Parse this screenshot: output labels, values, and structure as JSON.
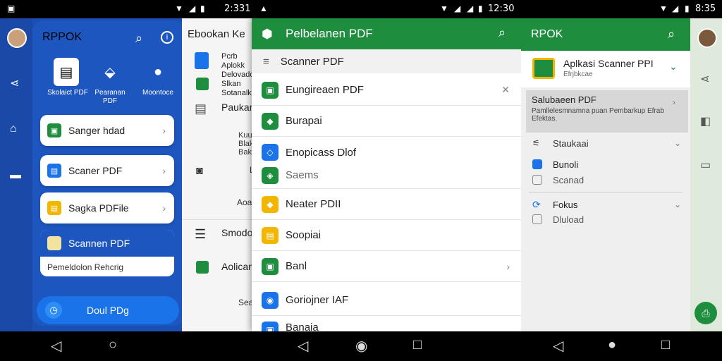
{
  "status_bar": {
    "left_time": "2:331",
    "mid_time": "12:30",
    "right_time": "8:35"
  },
  "panel1": {
    "title": "RPPOK",
    "tiles": [
      {
        "label": "Skolaict PDF",
        "icon": "document-icon"
      },
      {
        "label": "Pearanan PDF",
        "icon": "scan-shape-icon"
      },
      {
        "label": "Moontoce",
        "icon": "chat-bubble-icon"
      }
    ],
    "items": [
      {
        "label": "Sanger hdad",
        "color": "#1e8e3e"
      },
      {
        "label": "Scaner PDF",
        "color": "#1a73e8"
      },
      {
        "label": "Sagka PDFile",
        "color": "#f2b600"
      }
    ],
    "selected_item": {
      "label": "Scannen PDF",
      "sublabel": "Pemeldolon Rehcrig"
    },
    "action_button": "Doul PDg"
  },
  "panel2": {
    "title": "Ebookan Ke",
    "rows": [
      {
        "lines": [
          "Pcrb",
          "Aplokk",
          "Delovadoo"
        ]
      },
      {
        "lines": [
          "Slkan",
          "Sotanalk"
        ]
      },
      {
        "lines": [
          "Paukan"
        ]
      },
      {
        "lines": [
          "Kuuk",
          "Blak",
          "Baka"
        ]
      },
      {
        "lines": [
          "L"
        ]
      },
      {
        "lines": [
          "Aoa"
        ]
      },
      {
        "lines": [
          "Smodo"
        ]
      },
      {
        "lines": [
          "Aolican"
        ]
      },
      {
        "lines": [
          "Sea"
        ]
      }
    ]
  },
  "panel3": {
    "title": "Pelbelanen PDF",
    "subheader": "Scanner PDF",
    "rows": [
      {
        "label": "Eungireaen PDF",
        "color": "#1e8e3e",
        "chevron": "✕"
      },
      {
        "label": "Burapai",
        "color": "#1e8e3e",
        "chevron": ""
      },
      {
        "label": "Enopicass Dlof",
        "color": "#1a73e8",
        "chevron": ""
      },
      {
        "label": "Saems",
        "color": "#1e8e3e",
        "chevron": ""
      },
      {
        "label": "Neater PDII",
        "color": "#f2b600",
        "chevron": ""
      },
      {
        "label": "Soopiai",
        "color": "#f2b600",
        "chevron": ""
      },
      {
        "label": "Banl",
        "color": "#1e8e3e",
        "chevron": "›"
      },
      {
        "label": "Goriojner IAF",
        "color": "#1a73e8",
        "chevron": ""
      },
      {
        "label": "Banaia",
        "color": "#1a73e8",
        "chevron": ""
      }
    ]
  },
  "panel4": {
    "title": "RPOK",
    "app_title": "Aplkasi Scanner PPI",
    "app_sub": "Efrjbkcae",
    "highlight": {
      "title": "Salubaeen PDF",
      "desc": "Pamllelesmnamna puan Pembarkup Efrab Efektas."
    },
    "sections": [
      {
        "title": "Staukaai",
        "items": []
      },
      {
        "title": "",
        "items": [
          "Bunoli",
          "Scanad"
        ]
      },
      {
        "title": "Fokus",
        "items": [
          "Dluload"
        ]
      }
    ]
  }
}
